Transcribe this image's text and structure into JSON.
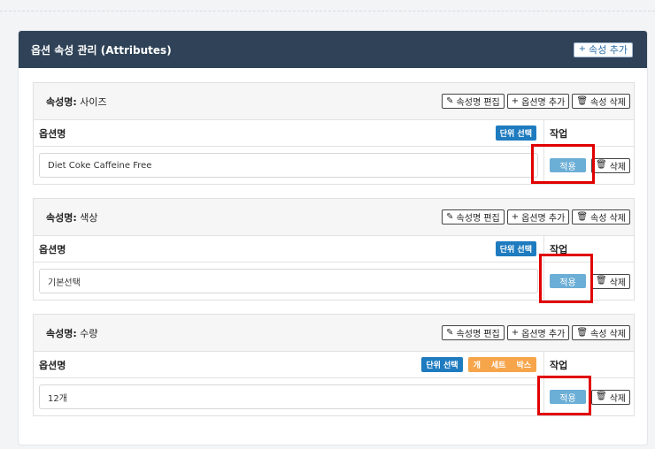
{
  "panel": {
    "title": "옵션 속성 관리 (Attributes)",
    "add_attribute_label": "속성 추가"
  },
  "common": {
    "edit_name_label": "속성명 편집",
    "add_option_label": "옵션명 추가",
    "delete_attribute_label": "속성 삭제",
    "col_option_name": "옵션명",
    "col_action": "작업",
    "unit_select_label": "단위 선택",
    "apply_label": "적용",
    "delete_label": "삭제",
    "attr_name_prefix": "속성명:"
  },
  "attributes": [
    {
      "name": "사이즈",
      "option_value": "Diet Coke Caffeine Free",
      "unit_tags": []
    },
    {
      "name": "색상",
      "option_value": "기본선택",
      "unit_tags": []
    },
    {
      "name": "수량",
      "option_value": "12개",
      "unit_tags": [
        "개",
        "세트",
        "박스"
      ]
    }
  ],
  "colors": {
    "header_bg": "#2f4257",
    "unit_badge": "#1e7bbf",
    "unit_tags_bg": "#f6a54b",
    "apply_bg": "#6baed6",
    "highlight": "#e00000"
  }
}
